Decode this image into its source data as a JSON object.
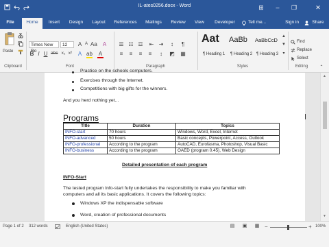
{
  "window": {
    "title": "IL-ates0256.docx - Word",
    "buttons": {
      "minimize": "–",
      "restore": "❐",
      "close": "✕",
      "options": "⊞"
    }
  },
  "tabs": [
    "File",
    "Home",
    "Insert",
    "Design",
    "Layout",
    "References",
    "Mailings",
    "Review",
    "View",
    "Developer"
  ],
  "tell_me": "Tell me...",
  "account": {
    "sign_in": "Sign in",
    "share": "Share"
  },
  "ribbon": {
    "paste": "Paste",
    "font_name": "Times New Ro",
    "font_size": "12",
    "styles": [
      {
        "preview": "Aat",
        "label": "¶ Heading 1"
      },
      {
        "preview": "AaBb",
        "label": "¶ Heading 2"
      },
      {
        "preview": "AaBbCcD",
        "label": "¶ Heading 3"
      }
    ],
    "find": "Find",
    "replace": "Replace",
    "select": "Select",
    "groups": {
      "clipboard": "Clipboard",
      "font": "Font",
      "paragraph": "Paragraph",
      "styles": "Styles",
      "editing": "Editing"
    }
  },
  "document": {
    "bullets_top": [
      "Practice on the schools computers.",
      "Exercises through the Internet.",
      "Competitions with big gifts for the winners."
    ],
    "intro": "And you herd nothing yet...",
    "heading": "Programs",
    "table": {
      "headers": [
        "Title",
        "Duration",
        "Topics"
      ],
      "rows": [
        [
          "INFO-start",
          "70 hours",
          "Windows, Word, Excel, Internet"
        ],
        [
          "INFO-advanced",
          "50 hours",
          "Basic concepts, Powerpoint, Access, Outlook"
        ],
        [
          "INFO-professional",
          "According to the program",
          "AutoCAD, Eurofasma, Photoshop, Visual Basic"
        ],
        [
          "INFO-business",
          "According to the program",
          "OAED (program 0.45), Web Design"
        ]
      ]
    },
    "detailed_title": "Detailed presentation of each program",
    "info_start_title": "INFO-Start",
    "paragraph": [
      "The tested program Info-start fully undertakes the responsibility to make you familiar with",
      "computers and all its basic applications. It covers the following topics:"
    ],
    "bullets_bottom": [
      "Windows XP the indispensable software",
      "Word, creation of professional documents"
    ]
  },
  "status": {
    "page": "Page 1 of 2",
    "words": "312 words",
    "language": "English (United States)",
    "zoom": "100%"
  }
}
